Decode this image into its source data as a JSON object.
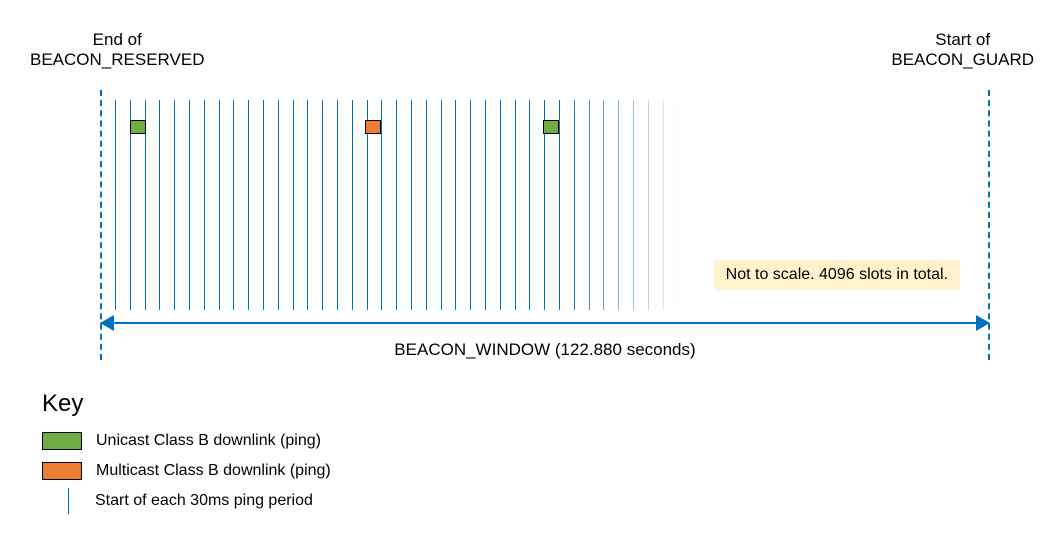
{
  "labels": {
    "top_left_line1": "End of",
    "top_left_line2": "BEACON_RESERVED",
    "top_right_line1": "Start of",
    "top_right_line2": "BEACON_GUARD",
    "note": "Not to scale. 4096 slots in total.",
    "window": "BEACON_WINDOW (122.880 seconds)"
  },
  "key": {
    "title": "Key",
    "unicast": "Unicast Class B downlink (ping)",
    "multicast": "Multicast Class B downlink (ping)",
    "tick": "Start of each 30ms ping period"
  },
  "chart_data": {
    "type": "diagram",
    "title": "Beacon window ping slot layout",
    "slot_count_total": 4096,
    "slot_duration_ms": 30,
    "window_duration_s": 122.88,
    "boundaries": {
      "left": "End of BEACON_RESERVED",
      "right": "Start of BEACON_GUARD"
    },
    "pings_shown": [
      {
        "slot_index_approx": 2,
        "type": "unicast",
        "color": "#70ad47"
      },
      {
        "slot_index_approx": 18,
        "type": "multicast",
        "color": "#ed7d31"
      },
      {
        "slot_index_approx": 30,
        "type": "unicast",
        "color": "#70ad47"
      }
    ],
    "note": "Not to scale. 4096 slots in total.",
    "legend": {
      "unicast": {
        "color": "#70ad47",
        "label": "Unicast Class B downlink (ping)"
      },
      "multicast": {
        "color": "#ed7d31",
        "label": "Multicast Class B downlink (ping)"
      },
      "tick": {
        "color": "#0070c0",
        "label": "Start of each 30ms ping period"
      }
    }
  }
}
